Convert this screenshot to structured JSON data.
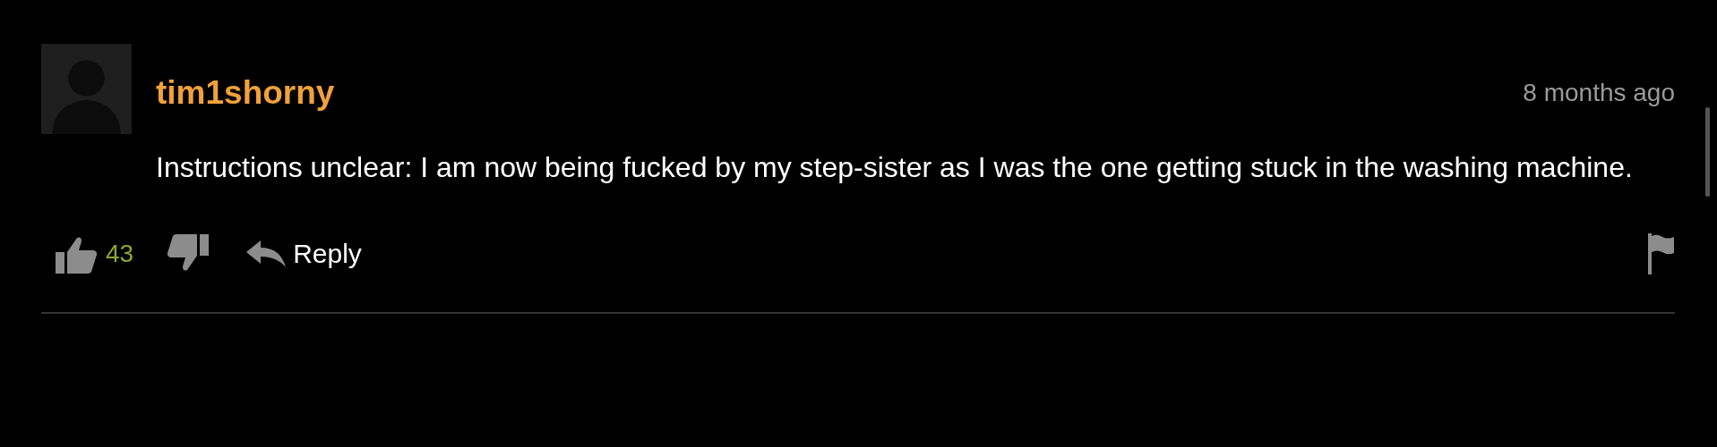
{
  "comment": {
    "username": "tim1shorny",
    "time": "8 months ago",
    "text": "Instructions unclear: I am now being fucked by my step-sister as I was the one getting stuck in the washing machine.",
    "likes": "43",
    "reply": "Reply"
  }
}
